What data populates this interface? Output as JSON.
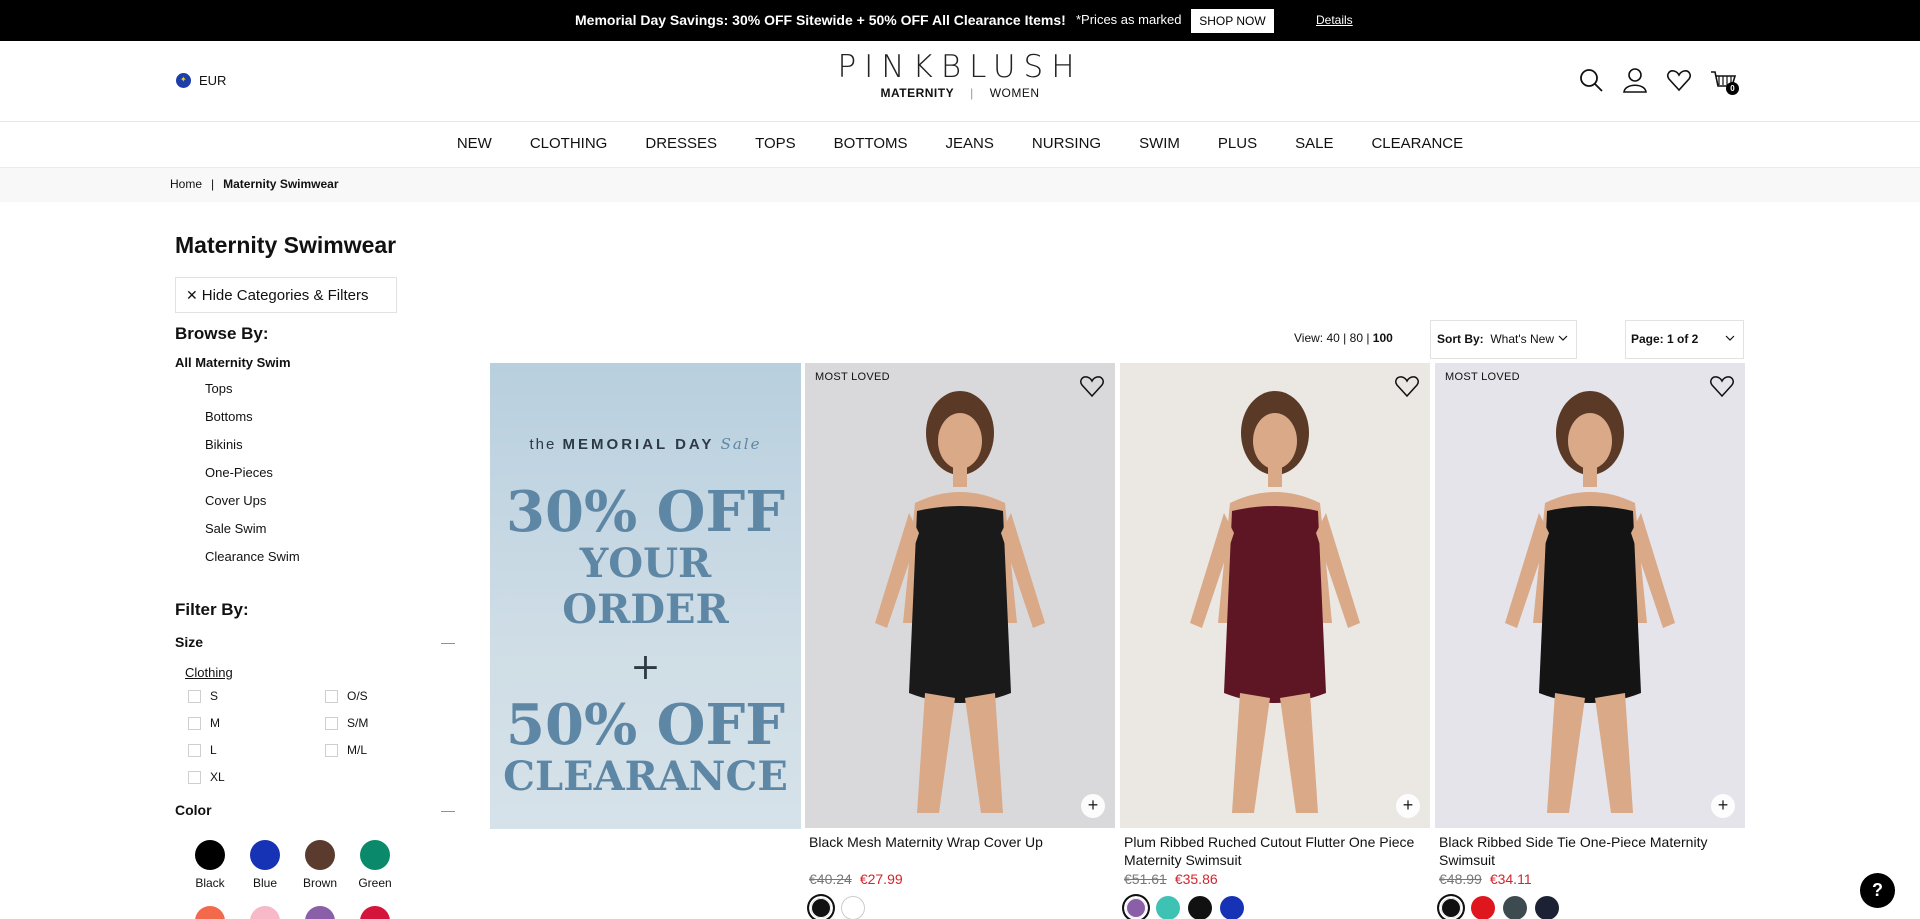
{
  "promo": {
    "headline": "Memorial Day Savings: 30% OFF Sitewide + 50% OFF All Clearance Items!",
    "note": "*Prices as marked",
    "shop_now": "SHOP NOW",
    "details": "Details"
  },
  "header": {
    "currency": "EUR",
    "brand": "PINKBLUSH",
    "sub_maternity": "MATERNITY",
    "sub_divider": "|",
    "sub_women": "WOMEN",
    "cart_count": "0",
    "icons": [
      "search-icon",
      "account-icon",
      "wishlist-heart-icon",
      "cart-icon"
    ]
  },
  "nav": [
    "NEW",
    "CLOTHING",
    "DRESSES",
    "TOPS",
    "BOTTOMS",
    "JEANS",
    "NURSING",
    "SWIM",
    "PLUS",
    "SALE",
    "CLEARANCE"
  ],
  "breadcrumb": {
    "home": "Home",
    "separator": "|",
    "current": "Maternity Swimwear"
  },
  "page_title": "Maternity Swimwear",
  "hide_filters": "Hide Categories & Filters",
  "browse": {
    "heading": "Browse By:",
    "all": "All Maternity Swim",
    "items": [
      "Tops",
      "Bottoms",
      "Bikinis",
      "One-Pieces",
      "Cover Ups",
      "Sale Swim",
      "Clearance Swim"
    ]
  },
  "filter": {
    "heading": "Filter By:",
    "size_heading": "Size",
    "size_group": "Clothing",
    "sizes_left": [
      "S",
      "M",
      "L",
      "XL"
    ],
    "sizes_right": [
      "O/S",
      "S/M",
      "M/L"
    ],
    "color_heading": "Color",
    "toggle": "—",
    "colors": [
      {
        "name": "Black",
        "hex": "#000000"
      },
      {
        "name": "Blue",
        "hex": "#1733b5"
      },
      {
        "name": "Brown",
        "hex": "#5a3b2e"
      },
      {
        "name": "Green",
        "hex": "#0a8a6a"
      }
    ],
    "colors_partial": [
      "#f26a4b",
      "#f7b8c8",
      "#8a5fa8",
      "#d4143a"
    ]
  },
  "toolbar": {
    "view_label": "View:",
    "view_40": "40",
    "view_80": "80",
    "view_100": "100",
    "sort_label": "Sort By:",
    "sort_value": "What's New",
    "page": "Page: 1 of 2"
  },
  "banner": {
    "pre": "the",
    "event": "MEMORIAL DAY",
    "sale": "Sale",
    "line1": "30% OFF",
    "line2": "YOUR ORDER",
    "plus": "+",
    "line3": "50% OFF",
    "line4": "CLEARANCE"
  },
  "products": [
    {
      "badge": "MOST LOVED",
      "name": "Black Mesh Maternity Wrap Cover Up",
      "old_price": "€40.24",
      "price": "€27.99",
      "swatches": [
        "#111111",
        "#ffffff"
      ],
      "bg": "#d9d9db",
      "body": "#1a1a1a"
    },
    {
      "badge": "",
      "name": "Plum Ribbed Ruched Cutout Flutter One Piece Maternity Swimsuit",
      "old_price": "€51.61",
      "price": "€35.86",
      "swatches": [
        "#8a5fa8",
        "#3dc2b4",
        "#111111",
        "#1733b5"
      ],
      "bg": "#ebe7e3",
      "body": "#5e1625"
    },
    {
      "badge": "MOST LOVED",
      "name": "Black Ribbed Side Tie One-Piece Maternity Swimsuit",
      "old_price": "€48.99",
      "price": "€34.11",
      "swatches": [
        "#111111",
        "#e0161f",
        "#3d4a4f",
        "#1c2233"
      ],
      "bg": "#e4e4ea",
      "body": "#141414"
    }
  ],
  "help": "?"
}
